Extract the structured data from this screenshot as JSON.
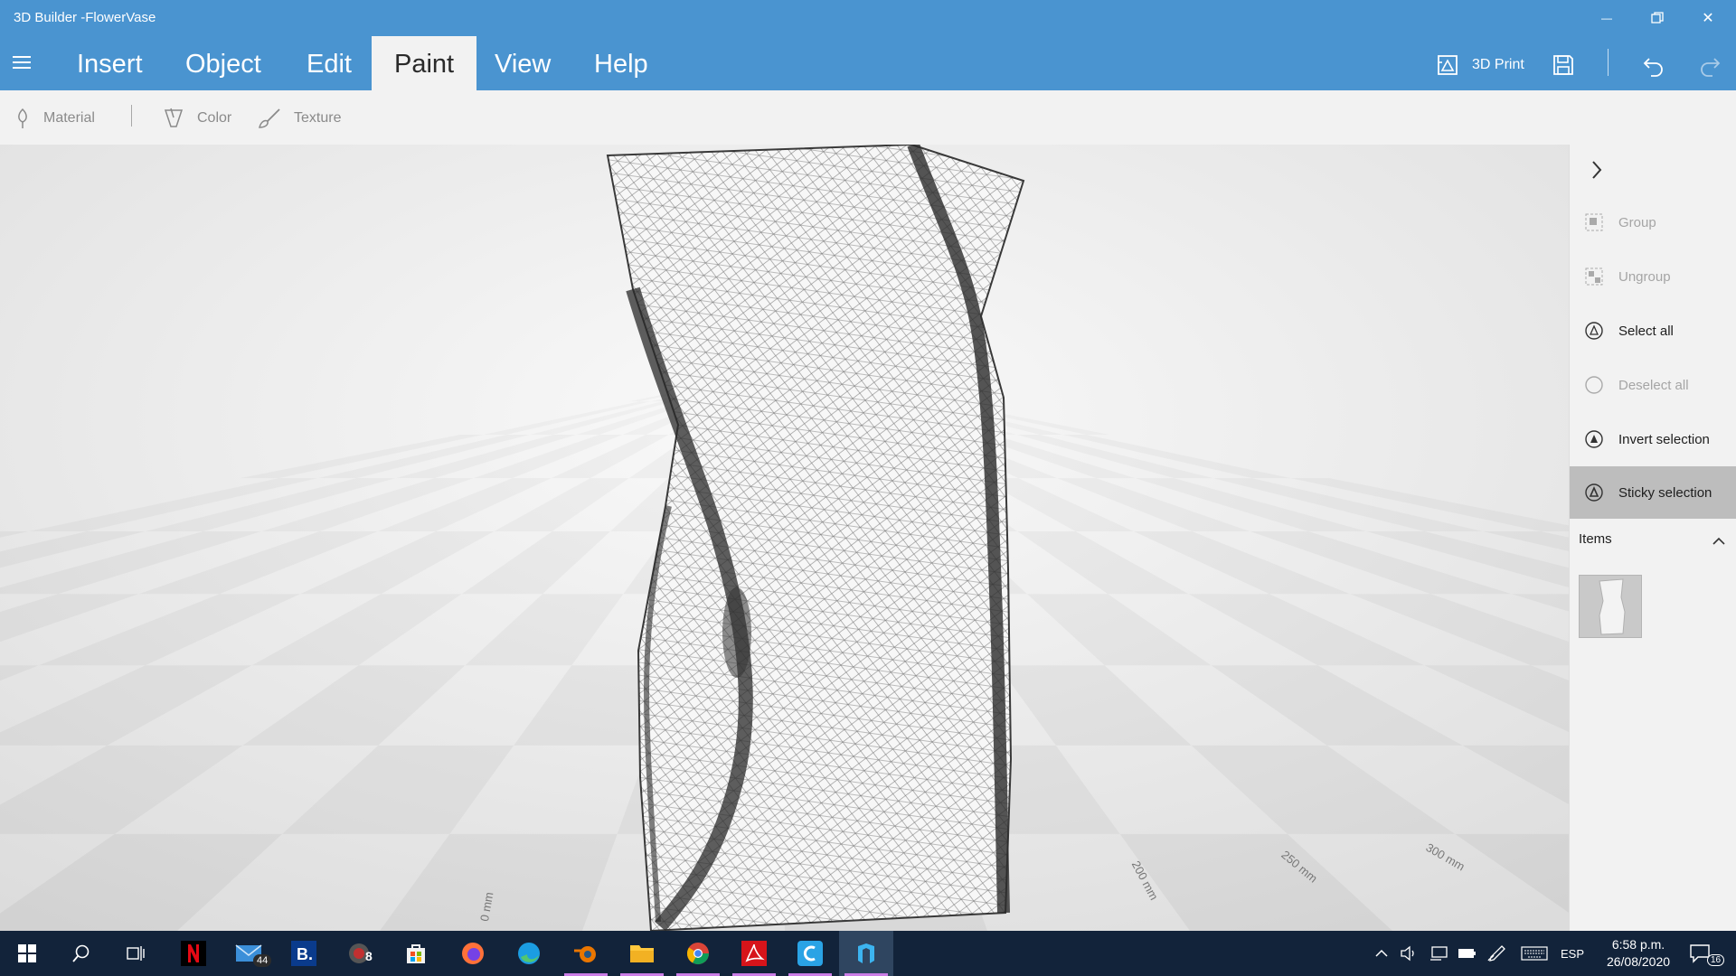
{
  "window": {
    "title": "3D Builder -FlowerVase",
    "minimize_glyph": "—",
    "close_glyph": "✕"
  },
  "ribbon": {
    "tabs": [
      {
        "label": "Insert",
        "active": false
      },
      {
        "label": "Object",
        "active": false
      },
      {
        "label": "Edit",
        "active": false
      },
      {
        "label": "Paint",
        "active": true
      },
      {
        "label": "View",
        "active": false
      },
      {
        "label": "Help",
        "active": false
      }
    ],
    "print_label": "3D Print"
  },
  "toolbar": {
    "material": "Material",
    "color": "Color",
    "texture": "Texture"
  },
  "viewport": {
    "labels": {
      "zero": "0 mm",
      "d200": "200 mm",
      "d250": "250 mm",
      "d300": "300 mm"
    }
  },
  "panel": {
    "items": [
      {
        "label": "Group",
        "state": "disabled"
      },
      {
        "label": "Ungroup",
        "state": "disabled"
      },
      {
        "label": "Select all",
        "state": "enabled"
      },
      {
        "label": "Deselect all",
        "state": "disabled"
      },
      {
        "label": "Invert selection",
        "state": "enabled"
      },
      {
        "label": "Sticky selection",
        "state": "selected"
      }
    ],
    "items_header": "Items"
  },
  "taskbar": {
    "mail_badge": "44",
    "app_badge": "8",
    "language": "ESP",
    "time": "6:58 p.m.",
    "date": "26/08/2020",
    "notifications": "16"
  },
  "colors": {
    "accent": "#4a94d0",
    "taskbar": "#12233a",
    "panel": "#f2f2f2",
    "selected_item": "#bdbdbd"
  }
}
